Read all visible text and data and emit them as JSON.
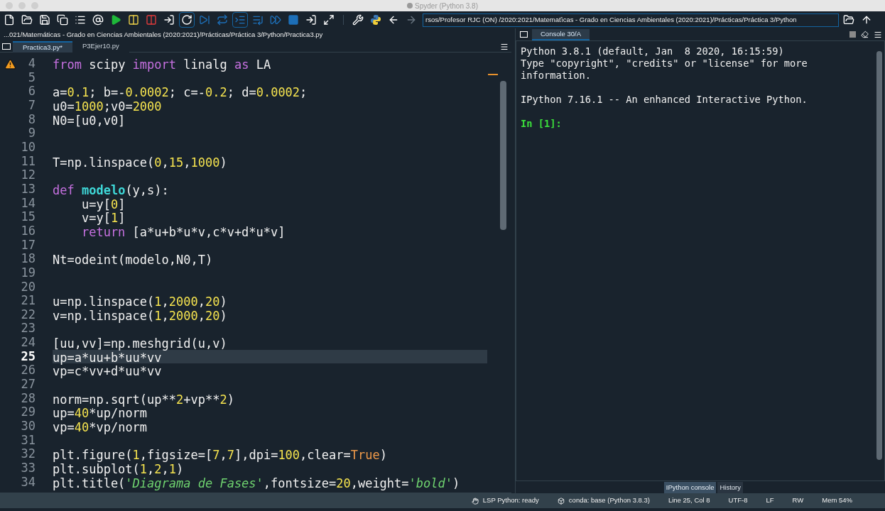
{
  "window": {
    "title": "Spyder (Python 3.8)"
  },
  "toolbar": {
    "path": "rsos/Profesor RJC (ON) /2020:2021/Matemaťicas - Grado en Ciencias Ambientales (2020:2021)/Prácticas/Práctica 3/Python"
  },
  "editor": {
    "file_path": "...021/Matemáticas - Grado en Ciencias Ambientales (2020:2021)/Prácticas/Práctica 3/Python/Practica3.py",
    "tabs": [
      {
        "label": "Practica3.py*",
        "selected": true
      },
      {
        "label": "P3Ejer10.py",
        "selected": false
      }
    ],
    "lines": [
      {
        "number": "4",
        "warning": true,
        "current": false,
        "tokens": [
          {
            "kind": "keyword",
            "text": "from"
          },
          {
            "kind": "plain",
            "text": " scipy "
          },
          {
            "kind": "keyword",
            "text": "import"
          },
          {
            "kind": "plain",
            "text": " linalg "
          },
          {
            "kind": "keyword",
            "text": "as"
          },
          {
            "kind": "plain",
            "text": " LA"
          }
        ]
      },
      {
        "number": "5",
        "warning": false,
        "current": false
      },
      {
        "number": "6",
        "warning": false,
        "current": false,
        "tokens": [
          {
            "kind": "plain",
            "text": "a="
          },
          {
            "kind": "number",
            "text": "0.1"
          },
          {
            "kind": "plain",
            "text": "; b=-"
          },
          {
            "kind": "number",
            "text": "0.0002"
          },
          {
            "kind": "plain",
            "text": "; c=-"
          },
          {
            "kind": "number",
            "text": "0.2"
          },
          {
            "kind": "plain",
            "text": "; d="
          },
          {
            "kind": "number",
            "text": "0.0002"
          },
          {
            "kind": "plain",
            "text": ";"
          }
        ]
      },
      {
        "number": "7",
        "warning": false,
        "current": false,
        "tokens": [
          {
            "kind": "plain",
            "text": "u0="
          },
          {
            "kind": "number",
            "text": "1000"
          },
          {
            "kind": "plain",
            "text": ";v0="
          },
          {
            "kind": "number",
            "text": "2000"
          }
        ]
      },
      {
        "number": "8",
        "warning": false,
        "current": false,
        "tokens": [
          {
            "kind": "plain",
            "text": "N0=[u0,v0]"
          }
        ]
      },
      {
        "number": "9",
        "warning": false,
        "current": false
      },
      {
        "number": "10",
        "warning": false,
        "current": false
      },
      {
        "number": "11",
        "warning": false,
        "current": false,
        "tokens": [
          {
            "kind": "plain",
            "text": "T=np.linspace("
          },
          {
            "kind": "number",
            "text": "0"
          },
          {
            "kind": "plain",
            "text": ","
          },
          {
            "kind": "number",
            "text": "15"
          },
          {
            "kind": "plain",
            "text": ","
          },
          {
            "kind": "number",
            "text": "1000"
          },
          {
            "kind": "plain",
            "text": ")"
          }
        ]
      },
      {
        "number": "12",
        "warning": false,
        "current": false
      },
      {
        "number": "13",
        "warning": false,
        "current": false,
        "tokens": [
          {
            "kind": "keyword",
            "text": "def "
          },
          {
            "kind": "function",
            "text": "modelo"
          },
          {
            "kind": "plain",
            "text": "(y,s):"
          }
        ]
      },
      {
        "number": "14",
        "warning": false,
        "current": false,
        "tokens": [
          {
            "kind": "plain",
            "text": "    u=y["
          },
          {
            "kind": "number",
            "text": "0"
          },
          {
            "kind": "plain",
            "text": "]"
          }
        ]
      },
      {
        "number": "15",
        "warning": false,
        "current": false,
        "tokens": [
          {
            "kind": "plain",
            "text": "    v=y["
          },
          {
            "kind": "number",
            "text": "1"
          },
          {
            "kind": "plain",
            "text": "]"
          }
        ]
      },
      {
        "number": "16",
        "warning": false,
        "current": false,
        "tokens": [
          {
            "kind": "keyword",
            "text": "    return"
          },
          {
            "kind": "plain",
            "text": " [a*u+b*u*v,c*v+d*u*v]"
          }
        ]
      },
      {
        "number": "17",
        "warning": false,
        "current": false
      },
      {
        "number": "18",
        "warning": false,
        "current": false,
        "tokens": [
          {
            "kind": "plain",
            "text": "Nt=odeint(modelo,N0,T)"
          }
        ]
      },
      {
        "number": "19",
        "warning": false,
        "current": false
      },
      {
        "number": "20",
        "warning": false,
        "current": false
      },
      {
        "number": "21",
        "warning": false,
        "current": false,
        "tokens": [
          {
            "kind": "plain",
            "text": "u=np.linspace("
          },
          {
            "kind": "number",
            "text": "1"
          },
          {
            "kind": "plain",
            "text": ","
          },
          {
            "kind": "number",
            "text": "2000"
          },
          {
            "kind": "plain",
            "text": ","
          },
          {
            "kind": "number",
            "text": "20"
          },
          {
            "kind": "plain",
            "text": ")"
          }
        ]
      },
      {
        "number": "22",
        "warning": false,
        "current": false,
        "tokens": [
          {
            "kind": "plain",
            "text": "v=np.linspace("
          },
          {
            "kind": "number",
            "text": "1"
          },
          {
            "kind": "plain",
            "text": ","
          },
          {
            "kind": "number",
            "text": "2000"
          },
          {
            "kind": "plain",
            "text": ","
          },
          {
            "kind": "number",
            "text": "20"
          },
          {
            "kind": "plain",
            "text": ")"
          }
        ]
      },
      {
        "number": "23",
        "warning": false,
        "current": false
      },
      {
        "number": "24",
        "warning": false,
        "current": false,
        "tokens": [
          {
            "kind": "plain",
            "text": "[uu,vv]=np.meshgrid(u,v)"
          }
        ]
      },
      {
        "number": "25",
        "warning": false,
        "current": true,
        "tokens": [
          {
            "kind": "plain",
            "text": "up=a*uu+b*uu*vv"
          }
        ]
      },
      {
        "number": "26",
        "warning": false,
        "current": false,
        "tokens": [
          {
            "kind": "plain",
            "text": "vp=c*vv+d*uu*vv"
          }
        ]
      },
      {
        "number": "27",
        "warning": false,
        "current": false
      },
      {
        "number": "28",
        "warning": false,
        "current": false,
        "tokens": [
          {
            "kind": "plain",
            "text": "norm=np.sqrt(up**"
          },
          {
            "kind": "number",
            "text": "2"
          },
          {
            "kind": "plain",
            "text": "+vp**"
          },
          {
            "kind": "number",
            "text": "2"
          },
          {
            "kind": "plain",
            "text": ")"
          }
        ]
      },
      {
        "number": "29",
        "warning": false,
        "current": false,
        "tokens": [
          {
            "kind": "plain",
            "text": "up="
          },
          {
            "kind": "number",
            "text": "40"
          },
          {
            "kind": "plain",
            "text": "*up/norm"
          }
        ]
      },
      {
        "number": "30",
        "warning": false,
        "current": false,
        "tokens": [
          {
            "kind": "plain",
            "text": "vp="
          },
          {
            "kind": "number",
            "text": "40"
          },
          {
            "kind": "plain",
            "text": "*vp/norm"
          }
        ]
      },
      {
        "number": "31",
        "warning": false,
        "current": false
      },
      {
        "number": "32",
        "warning": false,
        "current": false,
        "tokens": [
          {
            "kind": "plain",
            "text": "plt.figure("
          },
          {
            "kind": "number",
            "text": "1"
          },
          {
            "kind": "plain",
            "text": ",figsize=["
          },
          {
            "kind": "number",
            "text": "7"
          },
          {
            "kind": "plain",
            "text": ","
          },
          {
            "kind": "number",
            "text": "7"
          },
          {
            "kind": "plain",
            "text": "],dpi="
          },
          {
            "kind": "number",
            "text": "100"
          },
          {
            "kind": "plain",
            "text": ",clear="
          },
          {
            "kind": "constant",
            "text": "True"
          },
          {
            "kind": "plain",
            "text": ")"
          }
        ]
      },
      {
        "number": "33",
        "warning": false,
        "current": false,
        "tokens": [
          {
            "kind": "plain",
            "text": "plt.subplot("
          },
          {
            "kind": "number",
            "text": "1"
          },
          {
            "kind": "plain",
            "text": ","
          },
          {
            "kind": "number",
            "text": "2"
          },
          {
            "kind": "plain",
            "text": ","
          },
          {
            "kind": "number",
            "text": "1"
          },
          {
            "kind": "plain",
            "text": ")"
          }
        ]
      },
      {
        "number": "34",
        "warning": false,
        "current": false,
        "tokens": [
          {
            "kind": "plain",
            "text": "plt.title("
          },
          {
            "kind": "string",
            "text": "'Diagrama de Fases'"
          },
          {
            "kind": "plain",
            "text": ",fontsize="
          },
          {
            "kind": "number",
            "text": "20"
          },
          {
            "kind": "plain",
            "text": ",weight="
          },
          {
            "kind": "string",
            "text": "'bold'"
          },
          {
            "kind": "plain",
            "text": ")"
          }
        ]
      }
    ]
  },
  "console": {
    "tabs": [
      {
        "label": "Console 30/A",
        "selected": true
      }
    ],
    "lines": [
      {
        "kind": "output",
        "text": "Python 3.8.1 (default, Jan  8 2020, 16:15:59)"
      },
      {
        "kind": "output",
        "text": "Type \"copyright\", \"credits\" or \"license\" for more information."
      },
      {
        "kind": "blank"
      },
      {
        "kind": "output",
        "text": "IPython 7.16.1 -- An enhanced Interactive Python."
      },
      {
        "kind": "blank"
      },
      {
        "kind": "prompt",
        "text": "In [1]:"
      }
    ]
  },
  "pane_tabs": [
    {
      "label": "IPython console",
      "selected": true
    },
    {
      "label": "History",
      "selected": false
    }
  ],
  "status_bar": [
    {
      "kind": "lsp",
      "text": "LSP Python: ready"
    },
    {
      "kind": "conda",
      "text": "conda: base (Python 3.8.3)"
    },
    {
      "kind": "plain",
      "text": "Line 25, Col 8"
    },
    {
      "kind": "plain",
      "text": "UTF-8"
    },
    {
      "kind": "plain",
      "text": "LF"
    },
    {
      "kind": "plain",
      "text": "RW"
    },
    {
      "kind": "plain",
      "text": "Mem 54%"
    }
  ]
}
